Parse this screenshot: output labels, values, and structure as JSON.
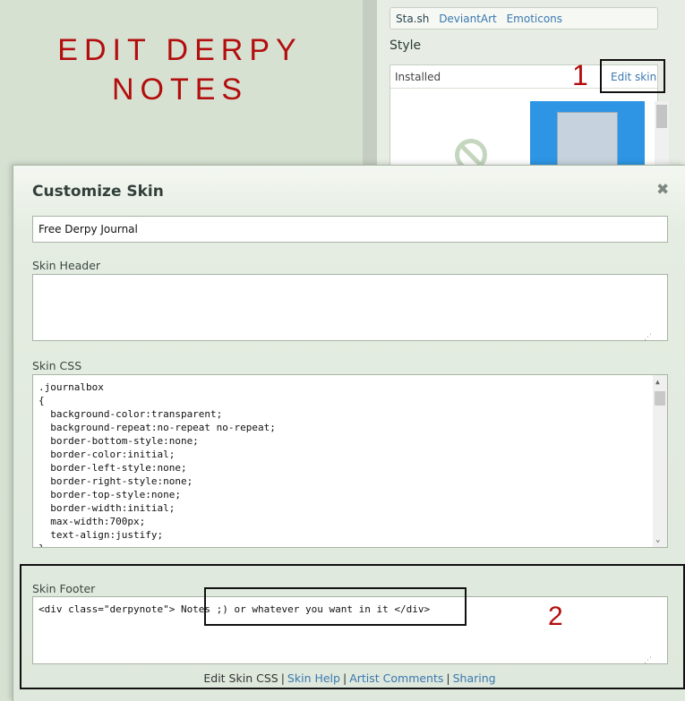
{
  "background": {
    "title_line1": "EDIT DERPY",
    "title_line2": "NOTES",
    "sidebar_tabs": [
      "Sta.sh",
      "DeviantArt",
      "Emoticons"
    ],
    "style_heading": "Style",
    "installed_label": "Installed",
    "edit_skin_label": "Edit skin",
    "annotation_1": "1"
  },
  "modal": {
    "title": "Customize Skin",
    "close_glyph": "✖",
    "skin_name_value": "Free Derpy Journal",
    "header_label": "Skin Header",
    "header_value": "",
    "css_label": "Skin CSS",
    "css_lines": [
      ".journalbox",
      "{",
      "  background-color:transparent;",
      "  background-repeat:no-repeat no-repeat;",
      "  border-bottom-style:none;",
      "  border-color:initial;",
      "  border-left-style:none;",
      "  border-right-style:none;",
      "  border-top-style:none;",
      "  border-width:initial;",
      "  max-width:700px;",
      "  text-align:justify;",
      "}"
    ],
    "footer_label": "Skin Footer",
    "footer_value": "<div class=\"derpynote\"> Notes ;) or whatever you want in it </div>",
    "links": {
      "edit_css": "Edit Skin CSS",
      "sep": "|",
      "skin_help": "Skin Help",
      "artist_comments": "Artist Comments",
      "sharing": "Sharing"
    },
    "annotation_2": "2"
  },
  "colors": {
    "annotation_red": "#b30d0d",
    "link_blue": "#3a78b0",
    "thumb_blue": "#2e95e4"
  }
}
